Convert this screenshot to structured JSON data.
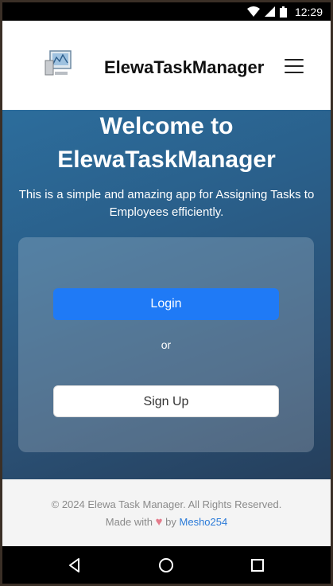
{
  "status_bar": {
    "time": "12:29",
    "icons": [
      "wifi-icon",
      "signal-icon",
      "battery-icon"
    ]
  },
  "header": {
    "logo_icon": "computer-logo-icon",
    "title": "ElewaTaskManager",
    "menu_icon": "hamburger-menu-icon"
  },
  "hero": {
    "title_line1": "Welcome to",
    "title_line2": "ElewaTaskManager",
    "subtitle": "This is a simple and amazing app for Assigning Tasks to Employees efficiently."
  },
  "auth_card": {
    "login_label": "Login",
    "or_label": "or",
    "signup_label": "Sign Up"
  },
  "footer": {
    "copyright": "© 2024 Elewa Task Manager. All Rights Reserved.",
    "made_with": "Made with",
    "heart": "♥",
    "by": "by",
    "author": "Mesho254"
  },
  "nav_bar": {
    "buttons": [
      "back-icon",
      "home-icon",
      "recents-icon"
    ]
  },
  "colors": {
    "primary": "#1f7af6",
    "link": "#2a7ad8",
    "hero_top": "#2c6d9c",
    "hero_bottom": "#253f5c"
  }
}
